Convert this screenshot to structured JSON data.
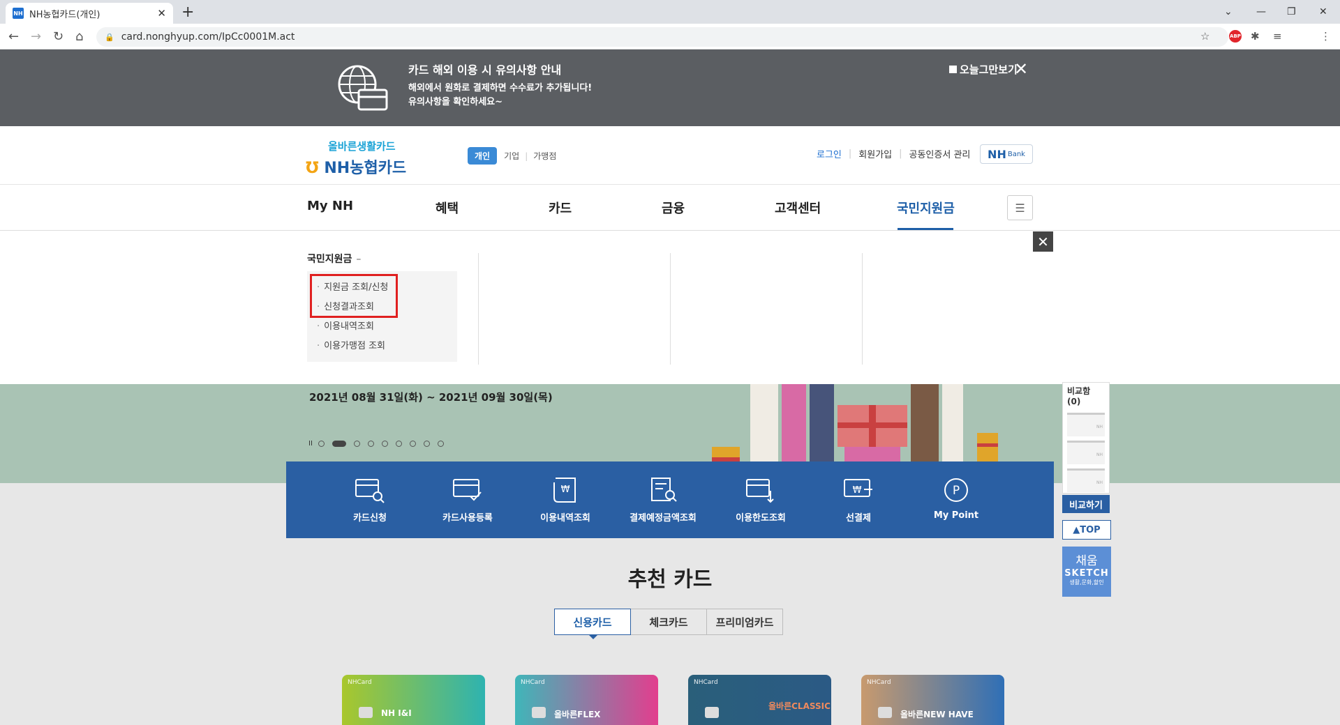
{
  "browser": {
    "tab_title": "NH농협카드(개인)",
    "favicon_text": "NH",
    "url": "card.nonghyup.com/IpCc0001M.act",
    "abp": "ABP"
  },
  "notice": {
    "title": "카드 해외 이용 시 유의사항 안내",
    "line1": "해외에서 원화로 결제하면 수수료가 추가됩니다!",
    "line2": "유의사항을 확인하세요~",
    "today_label": "오늘그만보기"
  },
  "header": {
    "logo_top": "올바른생활카드",
    "logo_main": "NH농협카드",
    "segments": [
      "개인",
      "기업",
      "가맹점"
    ],
    "util": [
      "로그인",
      "회원가입",
      "공동인증서 관리"
    ],
    "nhbank": "NH",
    "nhbank_small": "Bank"
  },
  "gnb": {
    "items": [
      "My NH",
      "혜택",
      "카드",
      "금융",
      "고객센터",
      "국민지원금"
    ]
  },
  "dropdown": {
    "heading": "국민지원금",
    "dash": "–",
    "items": [
      "지원금 조회/신청",
      "신청결과조회",
      "이용내역조회",
      "이용가맹점 조회"
    ]
  },
  "hero": {
    "date": "2021년 08월 31일(화) ~ 2021년 09월 30일(목)",
    "pause": "II"
  },
  "quick": {
    "items": [
      "카드신청",
      "카드사용등록",
      "이용내역조회",
      "결제예정금액조회",
      "이용한도조회",
      "선결제",
      "My Point"
    ]
  },
  "recommend": {
    "title": "추천 카드",
    "tabs": [
      "신용카드",
      "체크카드",
      "프리미엄카드"
    ],
    "cards": [
      {
        "brand": "NHCard",
        "name": "NH I&I",
        "color": "#7dbb2f"
      },
      {
        "brand": "NHCard",
        "name": "올바른FLEX",
        "color": "#d9478f"
      },
      {
        "brand": "NHCard",
        "name": "올바른CLASSIC",
        "color": "#2c5e82"
      },
      {
        "brand": "NHCard",
        "name": "올바른NEW HAVE",
        "color": "#2f6fb6"
      }
    ]
  },
  "side": {
    "compare_title": "비교함 (0)",
    "slot_label": "NH",
    "compare_btn": "비교하기",
    "top_btn": "▲TOP",
    "sketch1": "채움",
    "sketch2": "SKETCH",
    "sketch3": "생활,문화,할인"
  }
}
